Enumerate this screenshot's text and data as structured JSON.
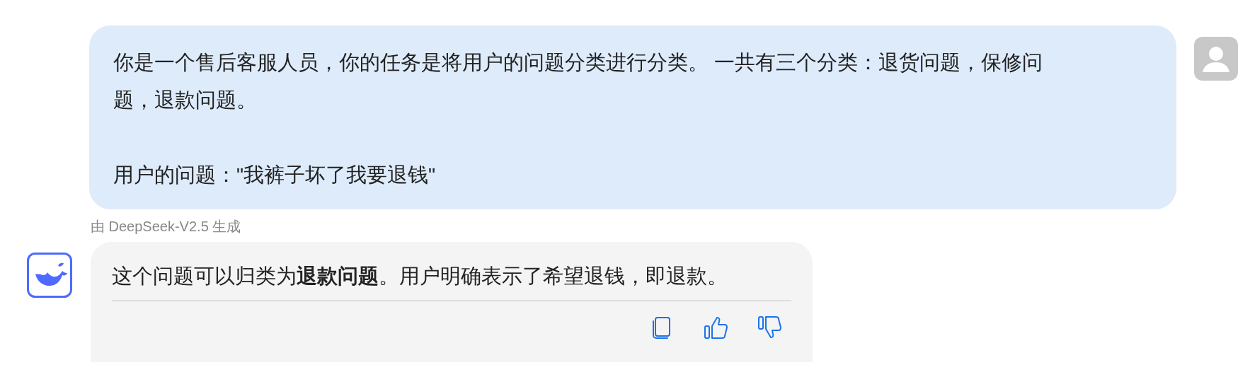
{
  "user_message": {
    "paragraphs": [
      "你是一个售后客服人员，你的任务是将用户的问题分类进行分类。 一共有三个分类：退货问题，保修问题，退款问题。",
      "用户的问题：\"我裤子坏了我要退钱\""
    ]
  },
  "model_label": "由 DeepSeek-V2.5 生成",
  "assistant_message": {
    "text": "这个问题可以归类为**退款问题**。用户明确表示了希望退钱，即退款。"
  }
}
